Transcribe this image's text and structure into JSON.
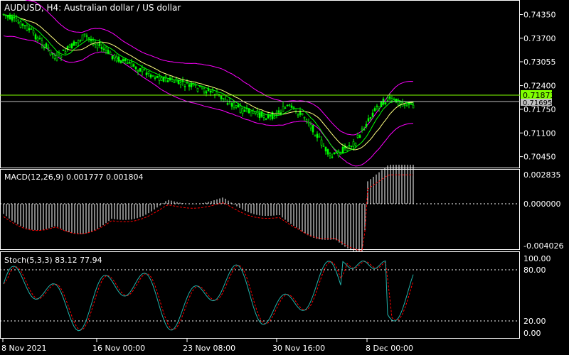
{
  "symbol_title": "AUDUSD, H4:  Australian dollar / US dollar",
  "price_axis": [
    "0.74350",
    "0.73700",
    "0.73055",
    "0.72400",
    "0.71750",
    "0.71100",
    "0.70450"
  ],
  "price_axis_range": [
    0.7015,
    0.7475
  ],
  "current_price_label": "0.71873",
  "secondary_price_label": "0.71695",
  "macd": {
    "title": "MACD(12,26,9) 0.001777 0.001804",
    "axis": [
      "0.002835",
      "0.000000",
      "-0.004026"
    ]
  },
  "stoch": {
    "title": "Stoch(5,3,3) 83.12 77.94",
    "axis": [
      "100.00",
      "80.00",
      "20.00",
      "0.00"
    ]
  },
  "time_axis": [
    "8 Nov 2021",
    "16 Nov 00:00",
    "23 Nov 08:00",
    "30 Nov 16:00",
    "8 Dec 00:00"
  ],
  "colors": {
    "background": "#000000",
    "candle": "#00ff00",
    "ma_fast": "#00ff00",
    "ma_slow": "#ffff80",
    "bands": "#ff00ff",
    "macd_hist": "#ffffff",
    "macd_signal": "#ff0000",
    "stoch_main": "#20b2aa",
    "stoch_signal": "#ff0000",
    "price_line": "#7fff00",
    "text": "#ffffff"
  }
}
